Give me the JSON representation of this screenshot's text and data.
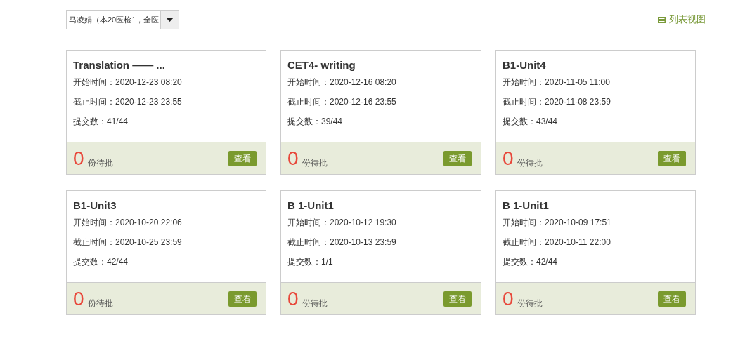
{
  "class_select": {
    "value": "马凌娟（本20医检1，全医"
  },
  "view_toggle": {
    "label": "列表视图"
  },
  "cards": [
    {
      "title": "Translation —— ...",
      "start": "开始时间：2020-12-23 08:20",
      "end": "截止时间：2020-12-23 23:55",
      "submitted": "提交数：41/44",
      "pending_count": "0",
      "pending_label": "份待批",
      "button": "查看"
    },
    {
      "title": "CET4- writing",
      "start": "开始时间：2020-12-16 08:20",
      "end": "截止时间：2020-12-16 23:55",
      "submitted": "提交数：39/44",
      "pending_count": "0",
      "pending_label": "份待批",
      "button": "查看"
    },
    {
      "title": "B1-Unit4",
      "start": "开始时间：2020-11-05 11:00",
      "end": "截止时间：2020-11-08 23:59",
      "submitted": "提交数：43/44",
      "pending_count": "0",
      "pending_label": "份待批",
      "button": "查看"
    },
    {
      "title": "B1-Unit3",
      "start": "开始时间：2020-10-20 22:06",
      "end": "截止时间：2020-10-25 23:59",
      "submitted": "提交数：42/44",
      "pending_count": "0",
      "pending_label": "份待批",
      "button": "查看"
    },
    {
      "title": "B 1-Unit1",
      "start": "开始时间：2020-10-12 19:30",
      "end": "截止时间：2020-10-13 23:59",
      "submitted": "提交数：1/1",
      "pending_count": "0",
      "pending_label": "份待批",
      "button": "查看"
    },
    {
      "title": "B 1-Unit1",
      "start": "开始时间：2020-10-09 17:51",
      "end": "截止时间：2020-10-11 22:00",
      "submitted": "提交数：42/44",
      "pending_count": "0",
      "pending_label": "份待批",
      "button": "查看"
    }
  ]
}
